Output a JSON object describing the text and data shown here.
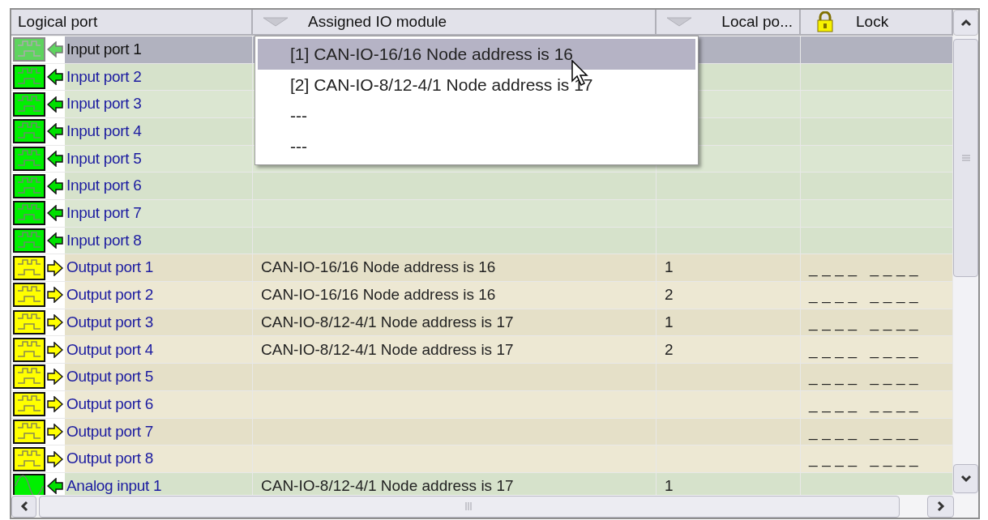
{
  "columns": [
    {
      "label": "Logical port",
      "kind": "plain"
    },
    {
      "label": "Assigned IO module",
      "kind": "filter"
    },
    {
      "label": "Local po...",
      "kind": "filter"
    },
    {
      "label": "Lock",
      "kind": "lock"
    }
  ],
  "rows": [
    {
      "kind": "input",
      "name": "Input port 1",
      "selected": true
    },
    {
      "kind": "input",
      "name": "Input port 2",
      "selected": false
    },
    {
      "kind": "input",
      "name": "Input port 3",
      "selected": false
    },
    {
      "kind": "input",
      "name": "Input port 4",
      "selected": false
    },
    {
      "kind": "input",
      "name": "Input port 5",
      "selected": false
    },
    {
      "kind": "input",
      "name": "Input port 6",
      "selected": false
    },
    {
      "kind": "input",
      "name": "Input port 7",
      "selected": false
    },
    {
      "kind": "input",
      "name": "Input port 8",
      "selected": false
    },
    {
      "kind": "output",
      "name": "Output port 1",
      "selected": false,
      "module": "CAN-IO-16/16 Node address is 16",
      "local_port": "1",
      "lock": "____ ____"
    },
    {
      "kind": "output",
      "name": "Output port 2",
      "selected": false,
      "module": "CAN-IO-16/16 Node address is 16",
      "local_port": "2",
      "lock": "____ ____"
    },
    {
      "kind": "output",
      "name": "Output port 3",
      "selected": false,
      "module": "CAN-IO-8/12-4/1 Node address is 17",
      "local_port": "1",
      "lock": "____ ____"
    },
    {
      "kind": "output",
      "name": "Output port 4",
      "selected": false,
      "module": "CAN-IO-8/12-4/1 Node address is 17",
      "local_port": "2",
      "lock": "____ ____"
    },
    {
      "kind": "output",
      "name": "Output port 5",
      "selected": false,
      "lock": "____ ____"
    },
    {
      "kind": "output",
      "name": "Output port 6",
      "selected": false,
      "lock": "____ ____"
    },
    {
      "kind": "output",
      "name": "Output port 7",
      "selected": false,
      "lock": "____ ____"
    },
    {
      "kind": "output",
      "name": "Output port 8",
      "selected": false,
      "lock": "____ ____"
    },
    {
      "kind": "analog",
      "name": "Analog input 1",
      "selected": false,
      "module": "CAN-IO-8/12-4/1 Node address is 17",
      "local_port": "1"
    }
  ],
  "dropdown": {
    "items": [
      {
        "label": "[1] CAN-IO-16/16 Node address is 16",
        "selected": true
      },
      {
        "label": "[2] CAN-IO-8/12-4/1 Node address is 17",
        "selected": false
      },
      {
        "label": "---",
        "selected": false
      },
      {
        "label": "---",
        "selected": false
      }
    ]
  }
}
